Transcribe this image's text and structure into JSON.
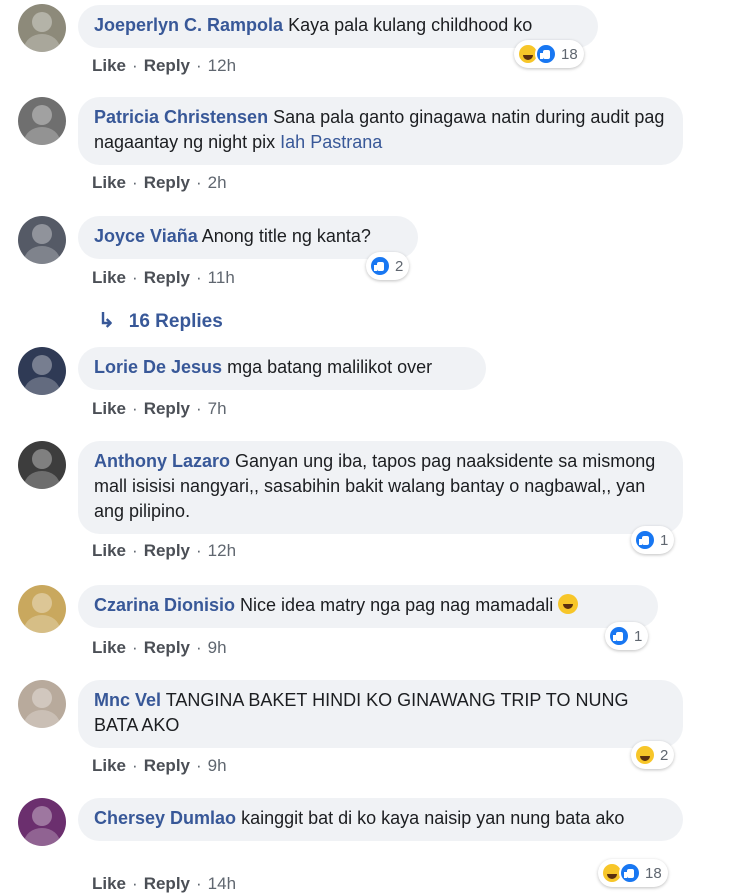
{
  "actions": {
    "like": "Like",
    "reply": "Reply"
  },
  "replies_link": {
    "arrow": "↳",
    "label": "16 Replies"
  },
  "comments": [
    {
      "author": "Joeperlyn C. Rampola",
      "text": "Kaya pala kulang childhood ko",
      "mention": "",
      "time": "12h",
      "reactions": [
        "haha",
        "like"
      ],
      "count": "18"
    },
    {
      "author": "Patricia Christensen",
      "text": "Sana pala ganto ginagawa natin during audit pag nagaantay ng night pix",
      "mention": "Iah Pastrana",
      "time": "2h",
      "reactions": [],
      "count": ""
    },
    {
      "author": "Joyce Viaña",
      "text": "Anong title ng kanta?",
      "mention": "",
      "time": "11h",
      "reactions": [
        "like"
      ],
      "count": "2"
    },
    {
      "author": "Lorie De Jesus",
      "text": "mga batang malilikot over",
      "mention": "",
      "time": "7h",
      "reactions": [],
      "count": ""
    },
    {
      "author": "Anthony Lazaro",
      "text": "Ganyan ung iba, tapos pag naaksidente sa mismong mall isisisi nangyari,, sasabihin bakit walang bantay o nagbawal,, yan ang pilipino.",
      "mention": "",
      "time": "12h",
      "reactions": [
        "like"
      ],
      "count": "1"
    },
    {
      "author": "Czarina Dionisio",
      "text": "Nice idea matry nga pag nag mamadali",
      "mention": "",
      "time": "9h",
      "reactions": [
        "like"
      ],
      "count": "1"
    },
    {
      "author": "Mnc Vel",
      "text": "TANGINA BAKET HINDI KO GINAWANG TRIP TO NUNG BATA AKO",
      "mention": "",
      "time": "9h",
      "reactions": [
        "haha"
      ],
      "count": "2"
    },
    {
      "author": "Chersey Dumlao",
      "text": "kainggit bat di ko kaya naisip yan nung bata ako",
      "mention": "",
      "time": "14h",
      "reactions": [
        "haha",
        "like"
      ],
      "count": "18"
    }
  ],
  "colors": {
    "author": "#385898",
    "bubble": "#f0f2f5",
    "like": "#1877f2",
    "haha": "#f7c629"
  }
}
